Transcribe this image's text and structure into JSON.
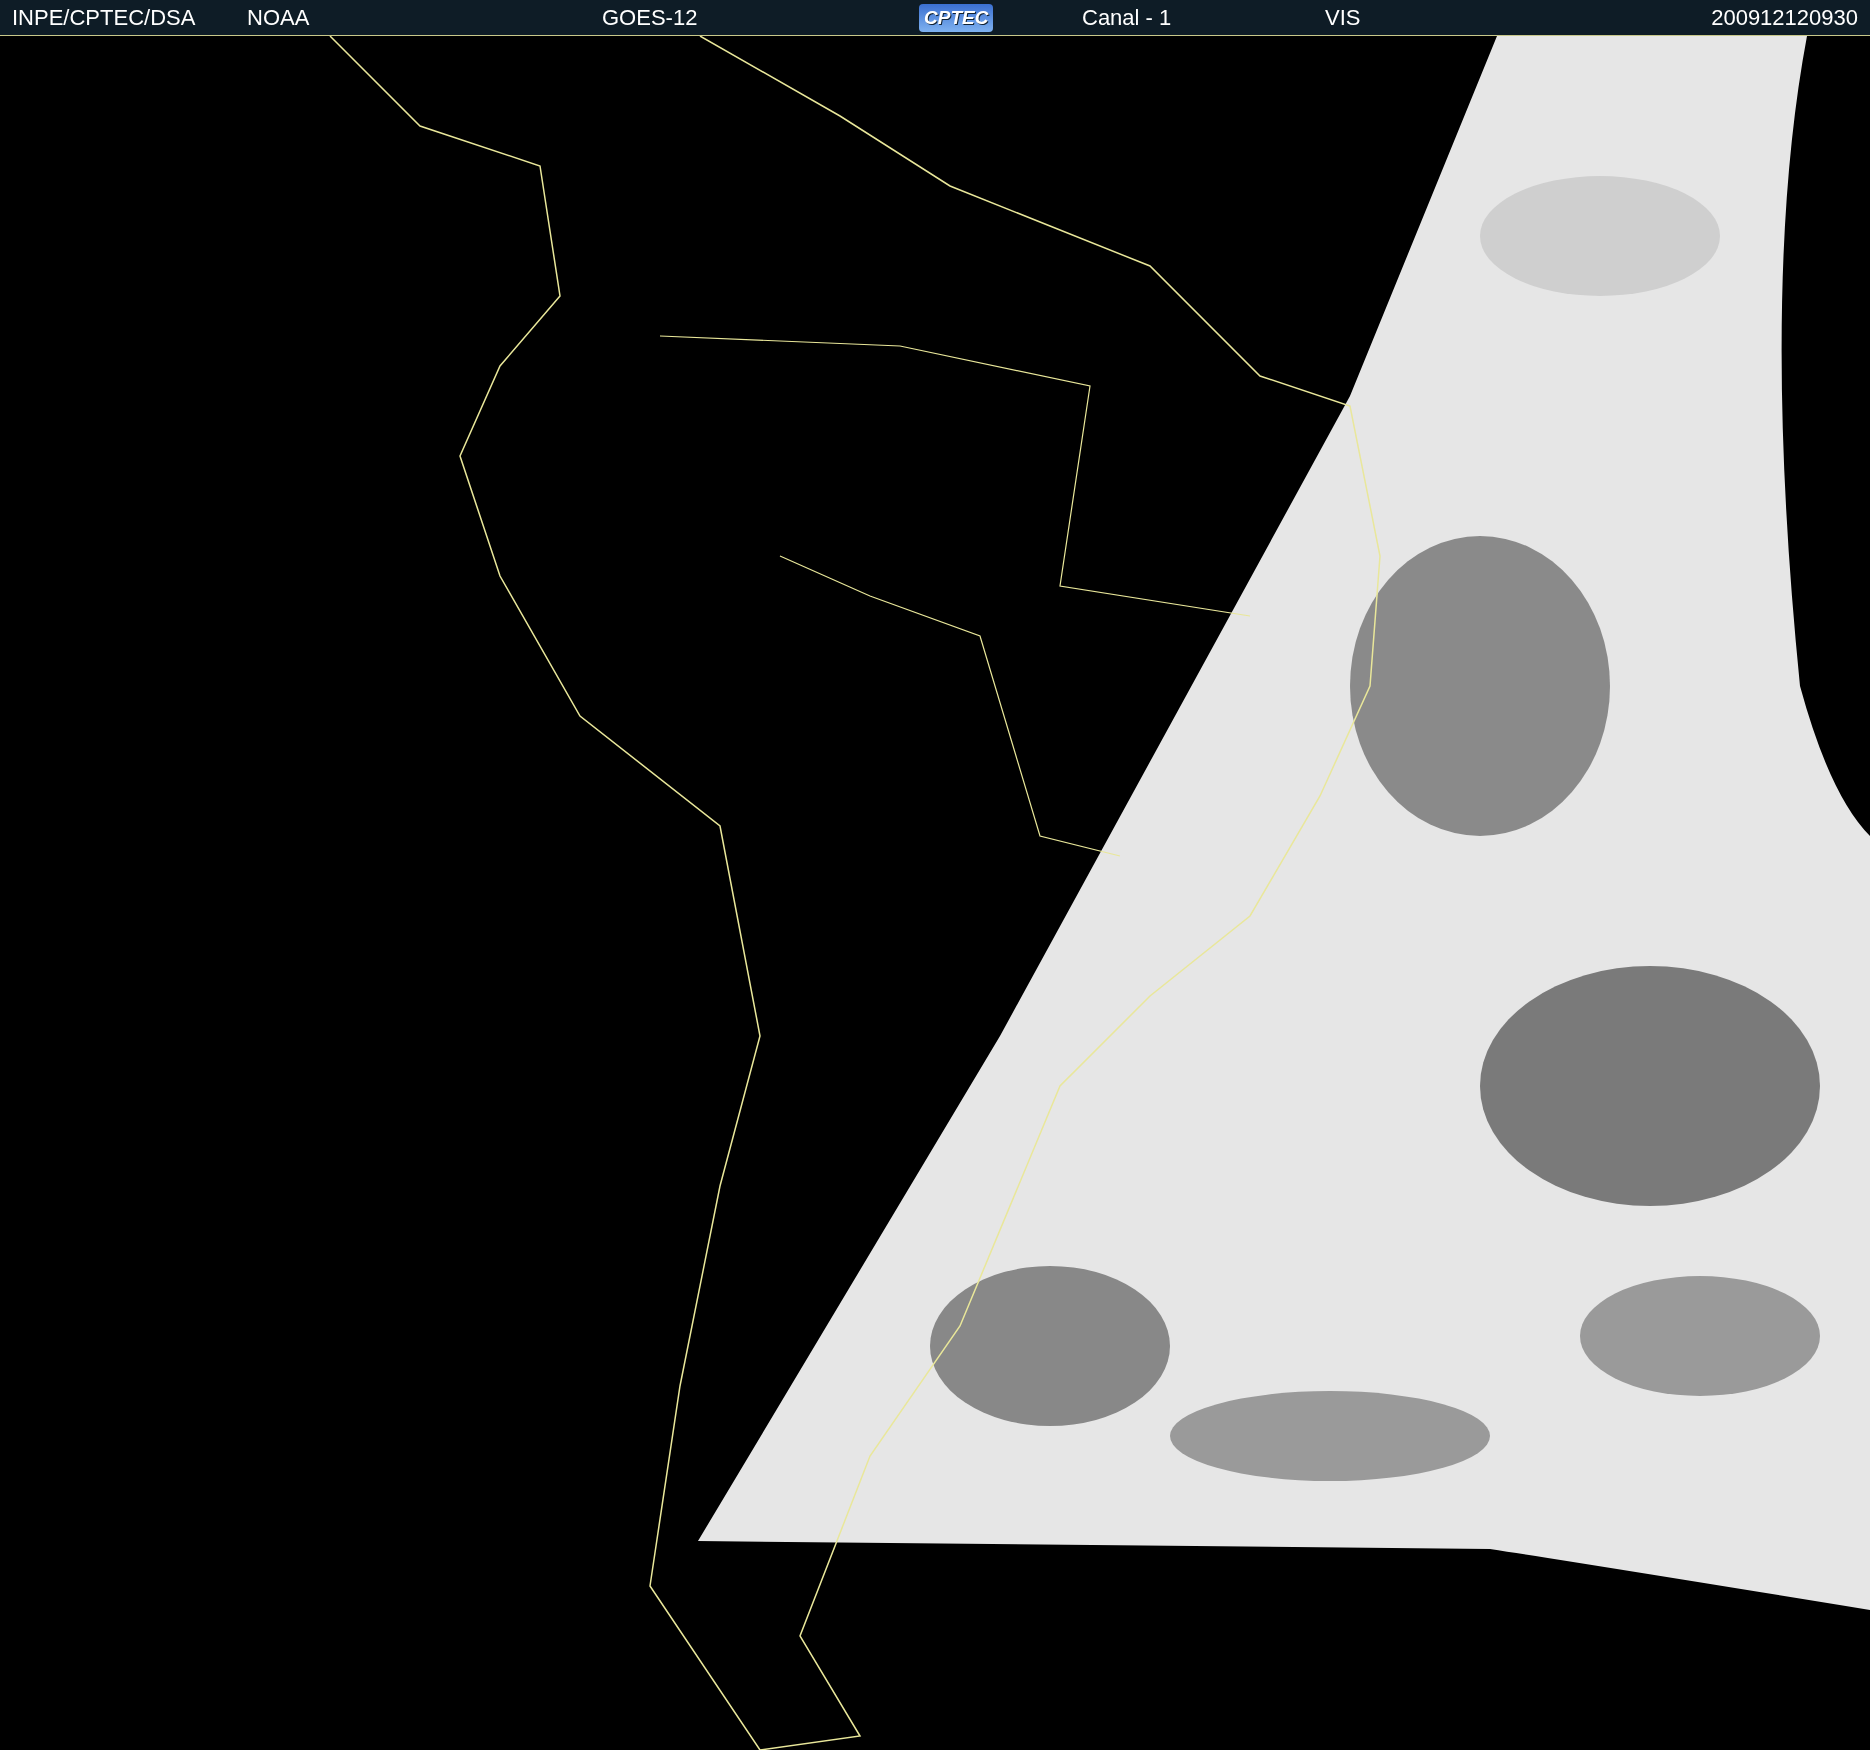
{
  "header": {
    "items": [
      {
        "kind": "text",
        "text": "INPE/CPTEC/DSA"
      },
      {
        "kind": "text",
        "text": "NOAA"
      },
      {
        "kind": "text",
        "text": "GOES-12"
      },
      {
        "kind": "logo",
        "text": "CPTEC"
      },
      {
        "kind": "text",
        "text": "Canal - 1"
      },
      {
        "kind": "text",
        "text": "VIS"
      },
      {
        "kind": "text",
        "text": "200912120930"
      }
    ]
  }
}
